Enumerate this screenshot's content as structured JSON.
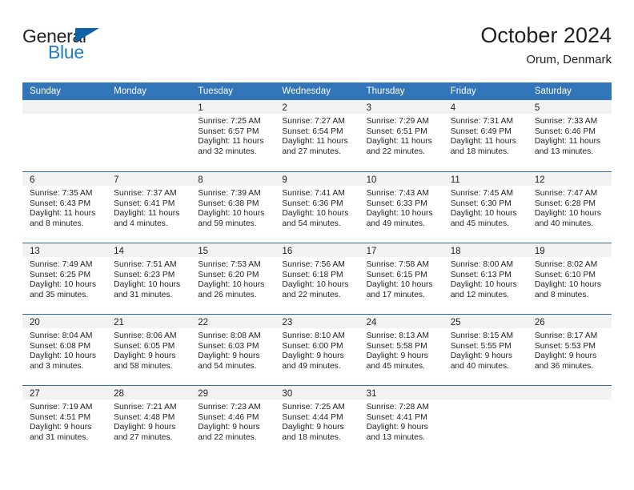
{
  "brand": {
    "name_dark": "General",
    "name_light": "Blue"
  },
  "header": {
    "title": "October 2024",
    "location": "Orum, Denmark"
  },
  "calendar": {
    "weekday_headers": [
      "Sunday",
      "Monday",
      "Tuesday",
      "Wednesday",
      "Thursday",
      "Friday",
      "Saturday"
    ],
    "colors": {
      "header_blue": "#3275b8",
      "week_divider": "#2e6ca8",
      "daynum_strip": "#f2f2f2",
      "text": "#231f20",
      "brand_blue": "#1f7dc4"
    },
    "weeks": [
      [
        {
          "day": ""
        },
        {
          "day": ""
        },
        {
          "day": "1",
          "sunrise": "Sunrise: 7:25 AM",
          "sunset": "Sunset: 6:57 PM",
          "daylight1": "Daylight: 11 hours",
          "daylight2": "and 32 minutes."
        },
        {
          "day": "2",
          "sunrise": "Sunrise: 7:27 AM",
          "sunset": "Sunset: 6:54 PM",
          "daylight1": "Daylight: 11 hours",
          "daylight2": "and 27 minutes."
        },
        {
          "day": "3",
          "sunrise": "Sunrise: 7:29 AM",
          "sunset": "Sunset: 6:51 PM",
          "daylight1": "Daylight: 11 hours",
          "daylight2": "and 22 minutes."
        },
        {
          "day": "4",
          "sunrise": "Sunrise: 7:31 AM",
          "sunset": "Sunset: 6:49 PM",
          "daylight1": "Daylight: 11 hours",
          "daylight2": "and 18 minutes."
        },
        {
          "day": "5",
          "sunrise": "Sunrise: 7:33 AM",
          "sunset": "Sunset: 6:46 PM",
          "daylight1": "Daylight: 11 hours",
          "daylight2": "and 13 minutes."
        }
      ],
      [
        {
          "day": "6",
          "sunrise": "Sunrise: 7:35 AM",
          "sunset": "Sunset: 6:43 PM",
          "daylight1": "Daylight: 11 hours",
          "daylight2": "and 8 minutes."
        },
        {
          "day": "7",
          "sunrise": "Sunrise: 7:37 AM",
          "sunset": "Sunset: 6:41 PM",
          "daylight1": "Daylight: 11 hours",
          "daylight2": "and 4 minutes."
        },
        {
          "day": "8",
          "sunrise": "Sunrise: 7:39 AM",
          "sunset": "Sunset: 6:38 PM",
          "daylight1": "Daylight: 10 hours",
          "daylight2": "and 59 minutes."
        },
        {
          "day": "9",
          "sunrise": "Sunrise: 7:41 AM",
          "sunset": "Sunset: 6:36 PM",
          "daylight1": "Daylight: 10 hours",
          "daylight2": "and 54 minutes."
        },
        {
          "day": "10",
          "sunrise": "Sunrise: 7:43 AM",
          "sunset": "Sunset: 6:33 PM",
          "daylight1": "Daylight: 10 hours",
          "daylight2": "and 49 minutes."
        },
        {
          "day": "11",
          "sunrise": "Sunrise: 7:45 AM",
          "sunset": "Sunset: 6:30 PM",
          "daylight1": "Daylight: 10 hours",
          "daylight2": "and 45 minutes."
        },
        {
          "day": "12",
          "sunrise": "Sunrise: 7:47 AM",
          "sunset": "Sunset: 6:28 PM",
          "daylight1": "Daylight: 10 hours",
          "daylight2": "and 40 minutes."
        }
      ],
      [
        {
          "day": "13",
          "sunrise": "Sunrise: 7:49 AM",
          "sunset": "Sunset: 6:25 PM",
          "daylight1": "Daylight: 10 hours",
          "daylight2": "and 35 minutes."
        },
        {
          "day": "14",
          "sunrise": "Sunrise: 7:51 AM",
          "sunset": "Sunset: 6:23 PM",
          "daylight1": "Daylight: 10 hours",
          "daylight2": "and 31 minutes."
        },
        {
          "day": "15",
          "sunrise": "Sunrise: 7:53 AM",
          "sunset": "Sunset: 6:20 PM",
          "daylight1": "Daylight: 10 hours",
          "daylight2": "and 26 minutes."
        },
        {
          "day": "16",
          "sunrise": "Sunrise: 7:56 AM",
          "sunset": "Sunset: 6:18 PM",
          "daylight1": "Daylight: 10 hours",
          "daylight2": "and 22 minutes."
        },
        {
          "day": "17",
          "sunrise": "Sunrise: 7:58 AM",
          "sunset": "Sunset: 6:15 PM",
          "daylight1": "Daylight: 10 hours",
          "daylight2": "and 17 minutes."
        },
        {
          "day": "18",
          "sunrise": "Sunrise: 8:00 AM",
          "sunset": "Sunset: 6:13 PM",
          "daylight1": "Daylight: 10 hours",
          "daylight2": "and 12 minutes."
        },
        {
          "day": "19",
          "sunrise": "Sunrise: 8:02 AM",
          "sunset": "Sunset: 6:10 PM",
          "daylight1": "Daylight: 10 hours",
          "daylight2": "and 8 minutes."
        }
      ],
      [
        {
          "day": "20",
          "sunrise": "Sunrise: 8:04 AM",
          "sunset": "Sunset: 6:08 PM",
          "daylight1": "Daylight: 10 hours",
          "daylight2": "and 3 minutes."
        },
        {
          "day": "21",
          "sunrise": "Sunrise: 8:06 AM",
          "sunset": "Sunset: 6:05 PM",
          "daylight1": "Daylight: 9 hours",
          "daylight2": "and 58 minutes."
        },
        {
          "day": "22",
          "sunrise": "Sunrise: 8:08 AM",
          "sunset": "Sunset: 6:03 PM",
          "daylight1": "Daylight: 9 hours",
          "daylight2": "and 54 minutes."
        },
        {
          "day": "23",
          "sunrise": "Sunrise: 8:10 AM",
          "sunset": "Sunset: 6:00 PM",
          "daylight1": "Daylight: 9 hours",
          "daylight2": "and 49 minutes."
        },
        {
          "day": "24",
          "sunrise": "Sunrise: 8:13 AM",
          "sunset": "Sunset: 5:58 PM",
          "daylight1": "Daylight: 9 hours",
          "daylight2": "and 45 minutes."
        },
        {
          "day": "25",
          "sunrise": "Sunrise: 8:15 AM",
          "sunset": "Sunset: 5:55 PM",
          "daylight1": "Daylight: 9 hours",
          "daylight2": "and 40 minutes."
        },
        {
          "day": "26",
          "sunrise": "Sunrise: 8:17 AM",
          "sunset": "Sunset: 5:53 PM",
          "daylight1": "Daylight: 9 hours",
          "daylight2": "and 36 minutes."
        }
      ],
      [
        {
          "day": "27",
          "sunrise": "Sunrise: 7:19 AM",
          "sunset": "Sunset: 4:51 PM",
          "daylight1": "Daylight: 9 hours",
          "daylight2": "and 31 minutes."
        },
        {
          "day": "28",
          "sunrise": "Sunrise: 7:21 AM",
          "sunset": "Sunset: 4:48 PM",
          "daylight1": "Daylight: 9 hours",
          "daylight2": "and 27 minutes."
        },
        {
          "day": "29",
          "sunrise": "Sunrise: 7:23 AM",
          "sunset": "Sunset: 4:46 PM",
          "daylight1": "Daylight: 9 hours",
          "daylight2": "and 22 minutes."
        },
        {
          "day": "30",
          "sunrise": "Sunrise: 7:25 AM",
          "sunset": "Sunset: 4:44 PM",
          "daylight1": "Daylight: 9 hours",
          "daylight2": "and 18 minutes."
        },
        {
          "day": "31",
          "sunrise": "Sunrise: 7:28 AM",
          "sunset": "Sunset: 4:41 PM",
          "daylight1": "Daylight: 9 hours",
          "daylight2": "and 13 minutes."
        },
        {
          "day": ""
        },
        {
          "day": ""
        }
      ]
    ]
  }
}
